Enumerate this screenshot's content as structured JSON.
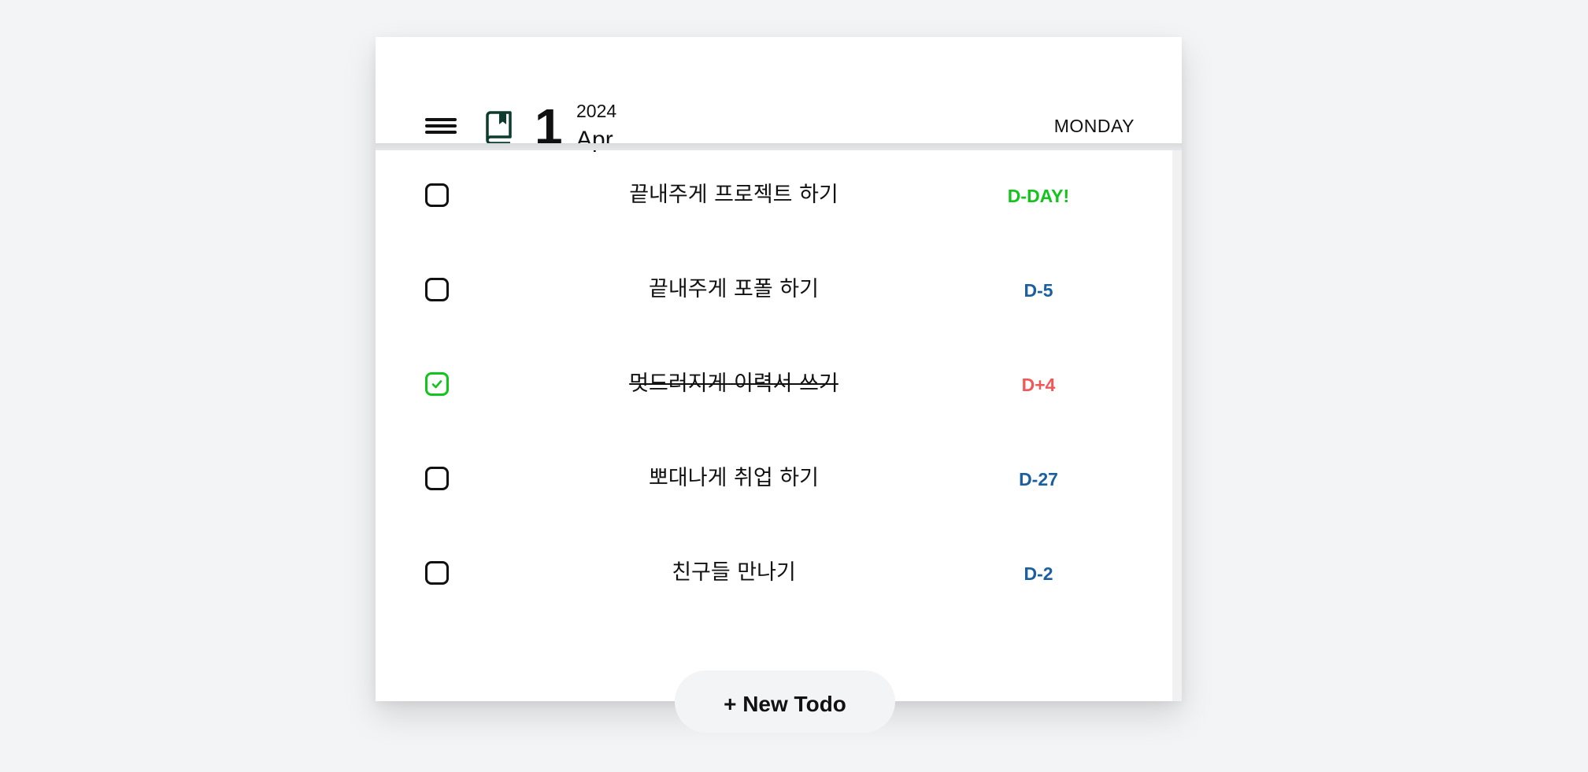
{
  "header": {
    "day": "1",
    "year": "2024",
    "month": "Apr",
    "weekday": "MONDAY"
  },
  "todos": [
    {
      "text": "끝내주게 프로젝트 하기",
      "done": false,
      "dday": "D-DAY!",
      "dday_color": "#12c41c"
    },
    {
      "text": "끝내주게 포폴 하기",
      "done": false,
      "dday": "D-5",
      "dday_color": "#1a5fa0"
    },
    {
      "text": "멋드러지게 이력서 쓰기",
      "done": true,
      "dday": "D+4",
      "dday_color": "#f25757"
    },
    {
      "text": "뽀대나게 취업 하기",
      "done": false,
      "dday": "D-27",
      "dday_color": "#1a5fa0"
    },
    {
      "text": "친구들 만나기",
      "done": false,
      "dday": "D-2",
      "dday_color": "#1a5fa0"
    }
  ],
  "new_todo_label": "+ New Todo",
  "colors": {
    "check_green": "#12c41c",
    "book_icon": "#0d3b2e",
    "background": "#f3f4f6"
  },
  "icons": {
    "menu": "hamburger-menu-icon",
    "book": "book-icon",
    "check": "check-icon"
  }
}
